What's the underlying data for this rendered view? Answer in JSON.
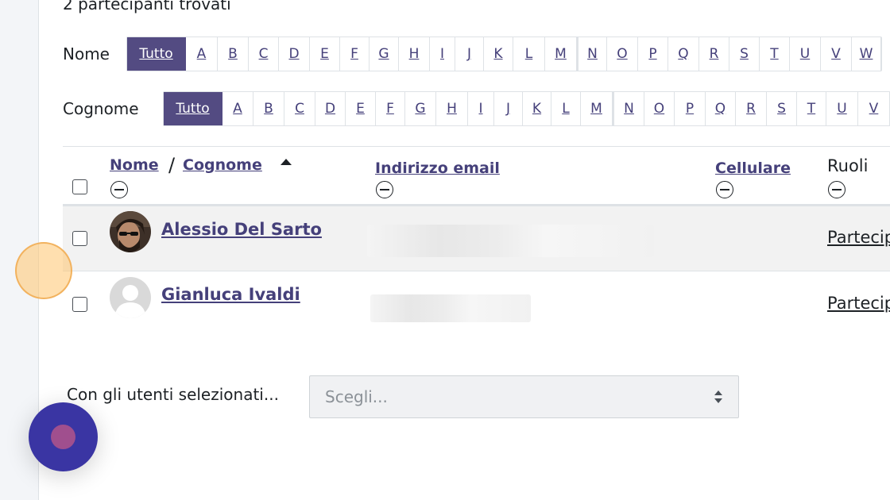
{
  "participants": {
    "count_text": "2 partecipanti trovati"
  },
  "filters": {
    "first_name_label": "Nome",
    "last_name_label": "Cognome",
    "all_label": "Tutto",
    "letters": [
      "A",
      "B",
      "C",
      "D",
      "E",
      "F",
      "G",
      "H",
      "I",
      "J",
      "K",
      "L",
      "M",
      "N",
      "O",
      "P",
      "Q",
      "R",
      "S",
      "T",
      "U",
      "V",
      "W"
    ]
  },
  "table": {
    "headers": {
      "first_name": "Nome",
      "separator": "/",
      "last_name": "Cognome",
      "email": "Indirizzo email",
      "mobile": "Cellulare",
      "roles": "Ruoli"
    },
    "rows": [
      {
        "name": "Alessio Del Sarto",
        "role": "Partecipante",
        "avatar": "photo"
      },
      {
        "name": "Gianluca Ivaldi",
        "role": "Partecipante",
        "avatar": "default-user-icon"
      }
    ]
  },
  "bulk_actions": {
    "label": "Con gli utenti selezionati...",
    "select_placeholder": "Scegli..."
  },
  "colors": {
    "accent": "#534b82",
    "link": "#45407a",
    "fab": "#3a35a3",
    "fab_dot": "#a04f8e",
    "row_highlight": "#f2f2f2"
  }
}
